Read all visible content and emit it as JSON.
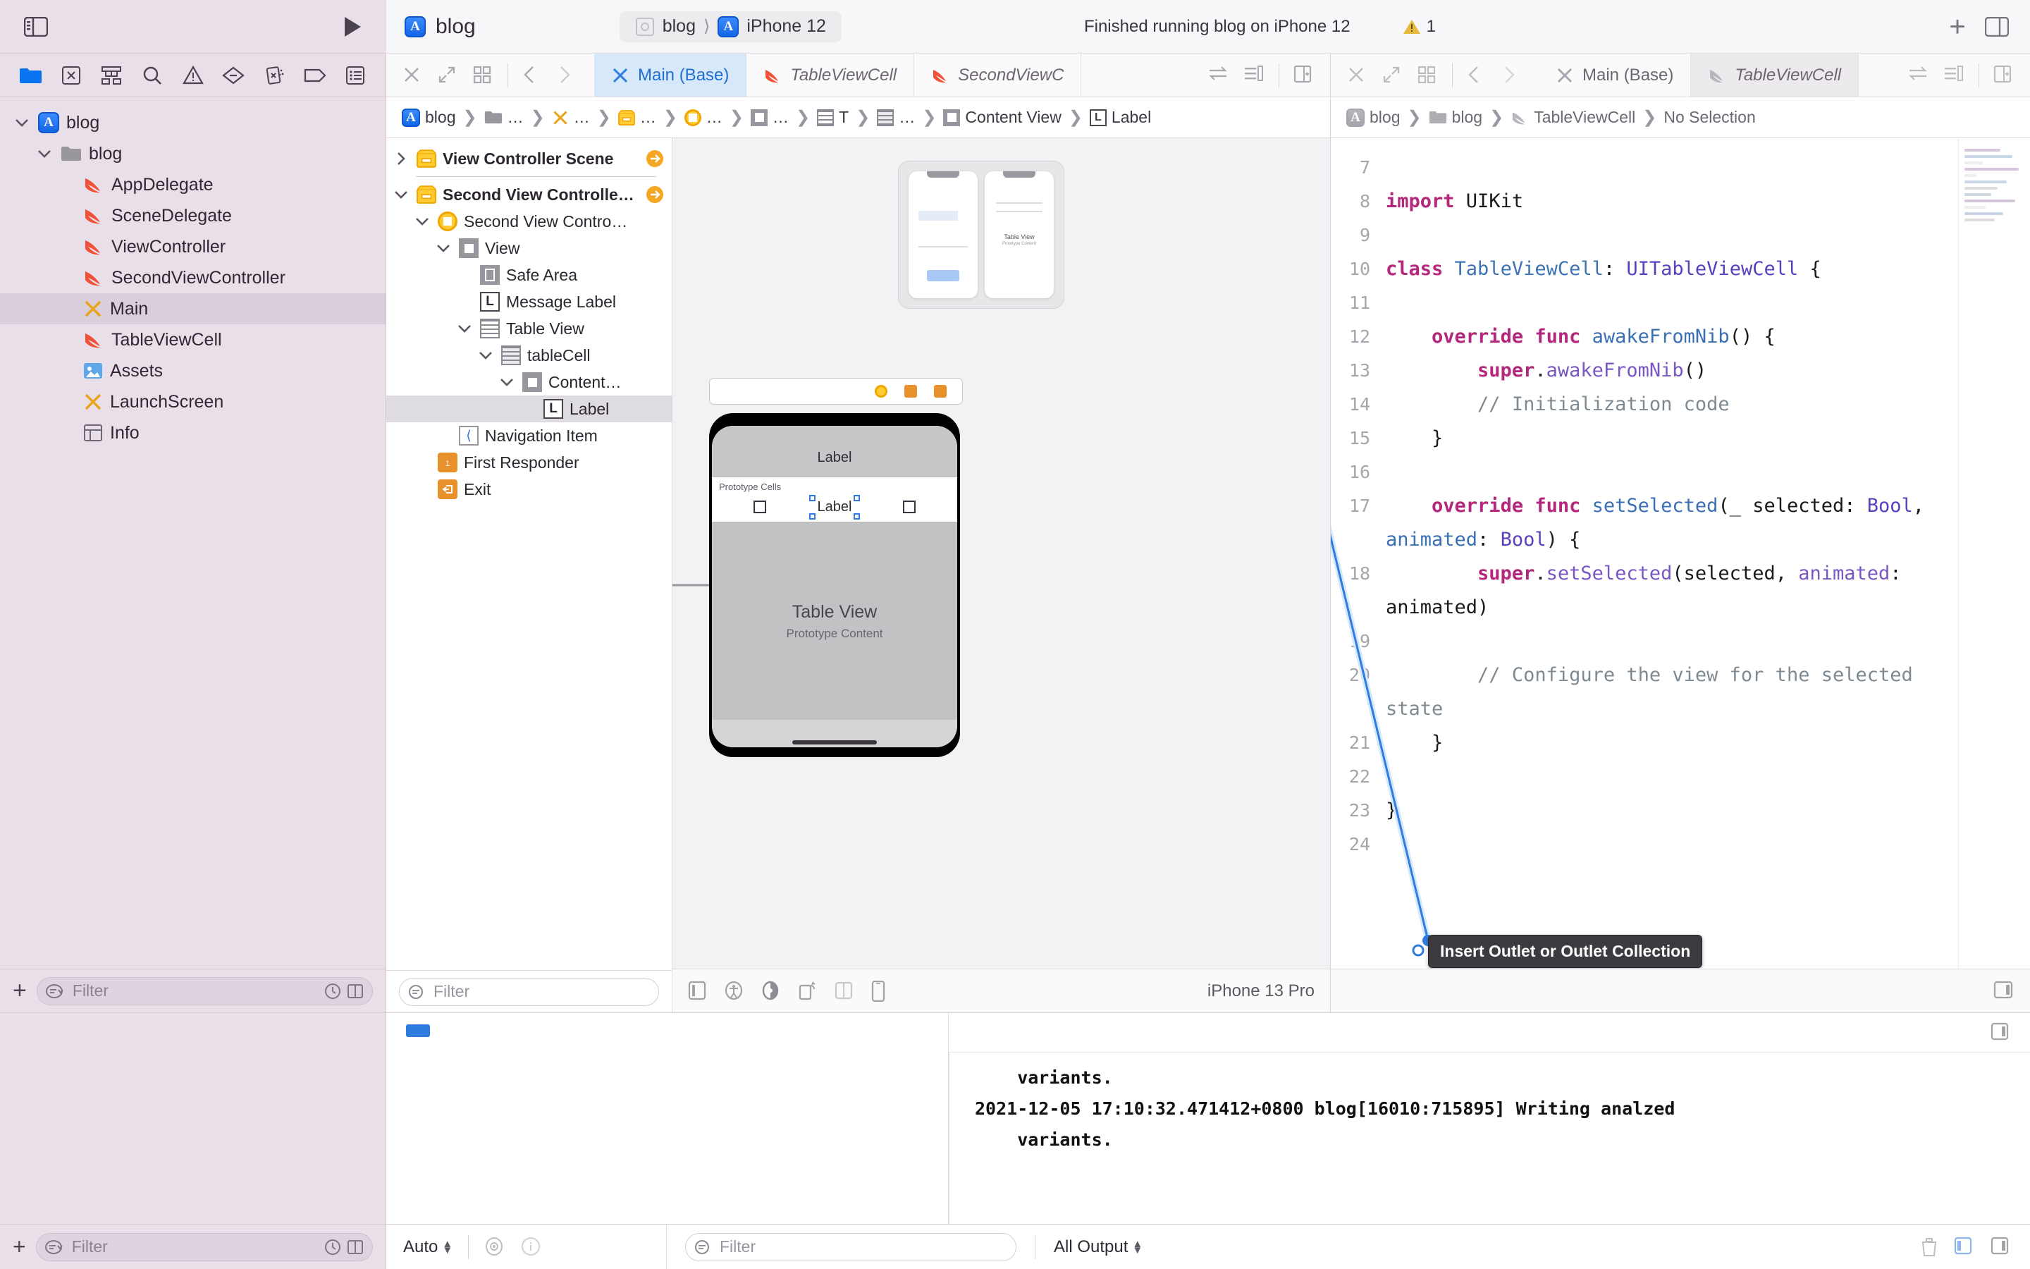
{
  "toolbar": {
    "sidebar_toggle_icon": "sidebar-left-icon",
    "run_icon": "run-play-icon",
    "project_name": "blog",
    "scheme_project": "blog",
    "scheme_destination": "iPhone 12",
    "status_message": "Finished running blog on iPhone 12",
    "warning_count": "1",
    "add_icon": "plus-icon",
    "inspector_toggle_icon": "sidebar-right-icon"
  },
  "navigator": {
    "tabs": [
      {
        "name": "folder-icon",
        "label": "Project navigator"
      },
      {
        "name": "source-control-icon",
        "label": "Source control"
      },
      {
        "name": "symbol-icon",
        "label": "Symbol navigator"
      },
      {
        "name": "search-icon",
        "label": "Find navigator"
      },
      {
        "name": "warning-triangle-icon",
        "label": "Issue navigator"
      },
      {
        "name": "test-diamond-icon",
        "label": "Test navigator"
      },
      {
        "name": "debug-icon",
        "label": "Debug navigator"
      },
      {
        "name": "breakpoint-tag-icon",
        "label": "Breakpoint navigator"
      },
      {
        "name": "report-list-icon",
        "label": "Report navigator"
      }
    ],
    "items": [
      {
        "label": "blog",
        "icon": "app-icon",
        "depth": 0,
        "disclosure": "open",
        "selected": false
      },
      {
        "label": "blog",
        "icon": "folder-icon",
        "depth": 1,
        "disclosure": "open",
        "selected": false
      },
      {
        "label": "AppDelegate",
        "icon": "swift-icon",
        "depth": 2,
        "disclosure": "none",
        "selected": false
      },
      {
        "label": "SceneDelegate",
        "icon": "swift-icon",
        "depth": 2,
        "disclosure": "none",
        "selected": false
      },
      {
        "label": "ViewController",
        "icon": "swift-icon",
        "depth": 2,
        "disclosure": "none",
        "selected": false
      },
      {
        "label": "SecondViewController",
        "icon": "swift-icon",
        "depth": 2,
        "disclosure": "none",
        "selected": false
      },
      {
        "label": "Main",
        "icon": "storyboard-icon",
        "depth": 2,
        "disclosure": "none",
        "selected": true
      },
      {
        "label": "TableViewCell",
        "icon": "swift-icon",
        "depth": 2,
        "disclosure": "none",
        "selected": false
      },
      {
        "label": "Assets",
        "icon": "assets-icon",
        "depth": 2,
        "disclosure": "none",
        "selected": false
      },
      {
        "label": "LaunchScreen",
        "icon": "storyboard-icon",
        "depth": 2,
        "disclosure": "none",
        "selected": false
      },
      {
        "label": "Info",
        "icon": "plist-icon",
        "depth": 2,
        "disclosure": "none",
        "selected": false
      }
    ],
    "filter_placeholder": "Filter",
    "add_button_icon": "plus-icon"
  },
  "editor_left": {
    "toolbar_icons": [
      "close-icon",
      "expand-icon",
      "grid-icon",
      "back-chevron-icon",
      "forward-chevron-icon"
    ],
    "tabs": [
      {
        "label": "Main (Base)",
        "icon": "storyboard-icon",
        "active": true,
        "italic": false
      },
      {
        "label": "TableViewCell",
        "icon": "swift-icon",
        "active": false,
        "italic": true
      },
      {
        "label": "SecondViewC",
        "icon": "swift-icon",
        "active": false,
        "italic": true
      }
    ],
    "right_icons": [
      "swap-icon",
      "lines-icon",
      "add-editor-icon"
    ],
    "breadcrumb": [
      "blog",
      "…",
      "…",
      "…",
      "…",
      "…",
      "T",
      "…",
      "Content View",
      "Label"
    ],
    "outline": [
      {
        "label": "View Controller Scene",
        "icon": "scene-icon",
        "depth": 0,
        "disclosure": "closed",
        "bold": true,
        "selected": false,
        "arrow": true
      },
      {
        "label": "Second View Controlle…",
        "icon": "scene-icon",
        "depth": 0,
        "disclosure": "open",
        "bold": true,
        "selected": false,
        "arrow": true
      },
      {
        "label": "Second View Contro…",
        "icon": "viewcontroller-icon",
        "depth": 1,
        "disclosure": "open",
        "bold": false,
        "selected": false,
        "arrow": false
      },
      {
        "label": "View",
        "icon": "view-box-icon",
        "depth": 2,
        "disclosure": "open",
        "bold": false,
        "selected": false,
        "arrow": false
      },
      {
        "label": "Safe Area",
        "icon": "safe-area-icon",
        "depth": 3,
        "disclosure": "none",
        "bold": false,
        "selected": false,
        "arrow": false
      },
      {
        "label": "Message Label",
        "icon": "label-icon",
        "depth": 3,
        "disclosure": "none",
        "bold": false,
        "selected": false,
        "arrow": false
      },
      {
        "label": "Table View",
        "icon": "tableview-icon",
        "depth": 3,
        "disclosure": "open",
        "bold": false,
        "selected": false,
        "arrow": false
      },
      {
        "label": "tableCell",
        "icon": "tablecell-icon",
        "depth": 4,
        "disclosure": "open",
        "bold": false,
        "selected": false,
        "arrow": false
      },
      {
        "label": "Content…",
        "icon": "view-box-icon",
        "depth": 5,
        "disclosure": "open",
        "bold": false,
        "selected": false,
        "arrow": false
      },
      {
        "label": "Label",
        "icon": "label-icon",
        "depth": 6,
        "disclosure": "none",
        "bold": false,
        "selected": true,
        "arrow": false
      },
      {
        "label": "Navigation Item",
        "icon": "navigation-item-icon",
        "depth": 2,
        "disclosure": "none",
        "bold": false,
        "selected": false,
        "arrow": false
      },
      {
        "label": "First Responder",
        "icon": "first-responder-icon",
        "depth": 1,
        "disclosure": "none",
        "bold": false,
        "selected": false,
        "arrow": false
      },
      {
        "label": "Exit",
        "icon": "exit-icon",
        "depth": 1,
        "disclosure": "none",
        "bold": false,
        "selected": false,
        "arrow": false
      }
    ],
    "outline_filter_placeholder": "Filter",
    "canvas": {
      "nav_title": "Label",
      "prototype_caption": "Prototype Cells",
      "cell_label": "Label",
      "tableview_title": "Table View",
      "tableview_subtitle": "Prototype Content",
      "mini_table_title": "Table View",
      "mini_table_subtitle": "Prototype Content",
      "device_name": "iPhone 13 Pro",
      "bottom_icons": [
        "panel-icon",
        "accessibility-icon",
        "appearance-icon",
        "orientation-icon",
        "split-icon",
        "device-icon"
      ]
    }
  },
  "editor_right": {
    "toolbar_icons": [
      "close-icon",
      "expand-icon",
      "grid-icon",
      "back-chevron-icon",
      "forward-chevron-icon"
    ],
    "tabs": [
      {
        "label": "Main (Base)",
        "icon": "storyboard-icon",
        "active": false,
        "italic": false
      },
      {
        "label": "TableViewCell",
        "icon": "swift-icon",
        "active": true,
        "italic": true
      }
    ],
    "right_icons": [
      "swap-icon",
      "lines-icon",
      "add-editor-icon"
    ],
    "breadcrumb": [
      "blog",
      "blog",
      "TableViewCell",
      "No Selection"
    ],
    "code_lines": [
      {
        "num": "7",
        "segments": []
      },
      {
        "num": "8",
        "segments": [
          {
            "t": "import",
            "c": "kw"
          },
          {
            "t": " UIKit",
            "c": ""
          }
        ]
      },
      {
        "num": "9",
        "segments": []
      },
      {
        "num": "10",
        "segments": [
          {
            "t": "class",
            "c": "kw"
          },
          {
            "t": " ",
            "c": ""
          },
          {
            "t": "TableViewCell",
            "c": "ty"
          },
          {
            "t": ": ",
            "c": ""
          },
          {
            "t": "UITableViewCell",
            "c": "ty2"
          },
          {
            "t": " {",
            "c": ""
          }
        ]
      },
      {
        "num": "11",
        "segments": []
      },
      {
        "num": "12",
        "segments": [
          {
            "t": "    ",
            "c": ""
          },
          {
            "t": "override func",
            "c": "kw"
          },
          {
            "t": " ",
            "c": ""
          },
          {
            "t": "awakeFromNib",
            "c": "fn"
          },
          {
            "t": "() {",
            "c": ""
          }
        ]
      },
      {
        "num": "13",
        "segments": [
          {
            "t": "        ",
            "c": ""
          },
          {
            "t": "super",
            "c": "kw"
          },
          {
            "t": ".",
            "c": ""
          },
          {
            "t": "awakeFromNib",
            "c": "pr"
          },
          {
            "t": "()",
            "c": ""
          }
        ]
      },
      {
        "num": "14",
        "segments": [
          {
            "t": "        // Initialization code",
            "c": "cm"
          }
        ]
      },
      {
        "num": "15",
        "segments": [
          {
            "t": "    }",
            "c": ""
          }
        ]
      },
      {
        "num": "16",
        "segments": []
      },
      {
        "num": "17",
        "segments": [
          {
            "t": "    ",
            "c": ""
          },
          {
            "t": "override func",
            "c": "kw"
          },
          {
            "t": " ",
            "c": ""
          },
          {
            "t": "setSelected",
            "c": "fn"
          },
          {
            "t": "(_ selected: ",
            "c": ""
          },
          {
            "t": "Bool",
            "c": "ty2"
          },
          {
            "t": ", ",
            "c": ""
          },
          {
            "t": "animated",
            "c": "fn"
          },
          {
            "t": ": ",
            "c": ""
          },
          {
            "t": "Bool",
            "c": "ty2"
          },
          {
            "t": ") {",
            "c": ""
          }
        ]
      },
      {
        "num": "18",
        "segments": [
          {
            "t": "        ",
            "c": ""
          },
          {
            "t": "super",
            "c": "kw"
          },
          {
            "t": ".",
            "c": ""
          },
          {
            "t": "setSelected",
            "c": "pr"
          },
          {
            "t": "(selected, ",
            "c": ""
          },
          {
            "t": "animated",
            "c": "pr"
          },
          {
            "t": ": animated)",
            "c": ""
          }
        ]
      },
      {
        "num": "19",
        "segments": []
      },
      {
        "num": "20",
        "segments": [
          {
            "t": "        // Configure the view for the selected state",
            "c": "cm"
          }
        ]
      },
      {
        "num": "21",
        "segments": [
          {
            "t": "    }",
            "c": ""
          }
        ]
      },
      {
        "num": "22",
        "segments": []
      },
      {
        "num": "23",
        "segments": [
          {
            "t": "}",
            "c": ""
          }
        ]
      },
      {
        "num": "24",
        "segments": []
      }
    ],
    "tooltip": "Insert Outlet or Outlet Collection"
  },
  "console": {
    "log_lines": [
      "    variants.",
      "2021-12-05 17:10:32.471412+0800 blog[16010:715895] Writing analzed",
      "    variants."
    ],
    "filter_placeholder": "Filter",
    "output_selector": "All Output",
    "trash_icon": "trash-icon",
    "console_toggle_icons": [
      "left-panel-icon",
      "right-panel-icon"
    ]
  },
  "statusbar": {
    "add_icon": "plus-icon",
    "nav_filter_placeholder": "Filter",
    "nav_filter_icons": [
      "recent-icon",
      "source-control-filter-icon"
    ],
    "debug_scale": "Auto",
    "debug_icons": [
      "eye-icon",
      "info-icon"
    ],
    "debug_filter_placeholder": "Filter"
  },
  "colors": {
    "accent": "#2f7ce0",
    "navigator_bg": "#e9dfe9",
    "selection": "#d7e8fb",
    "swift_orange": "#f05138",
    "storyboard_yellow": "#e8a317",
    "keyword_pink": "#b5277d",
    "type_blue": "#3d72b3",
    "comment_gray": "#7e8a92"
  }
}
